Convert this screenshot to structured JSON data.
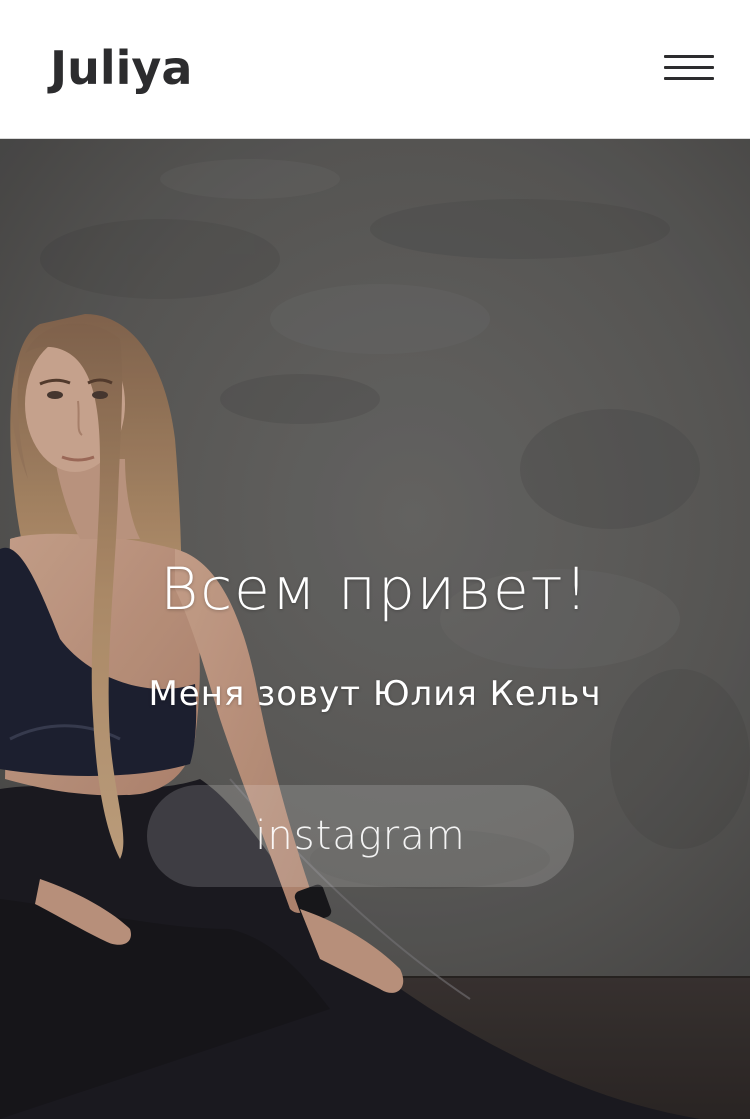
{
  "header": {
    "logo_text": "Juliya",
    "menu_icon": "hamburger-menu-icon"
  },
  "hero": {
    "background": "photo of a woman in black sportswear stretching in a lunge against a grey concrete wall",
    "title": "Всем привет!",
    "subtitle": "Меня зовут Юлия Кельч",
    "button_label": "instagram"
  },
  "colors": {
    "header_bg": "#ffffff",
    "logo_text": "#2c2c2e",
    "hero_text": "#ffffff",
    "button_bg": "rgba(255,255,255,0.16)"
  }
}
